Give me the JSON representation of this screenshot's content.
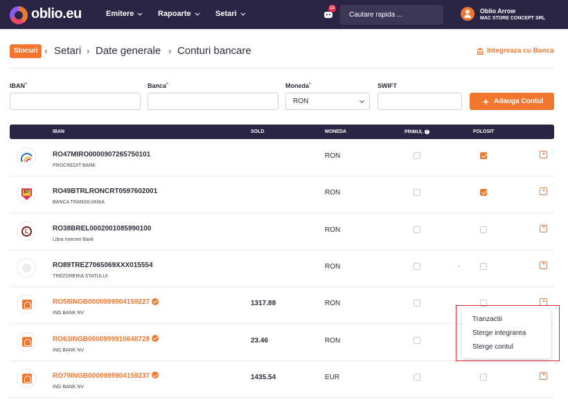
{
  "app": {
    "logo_text": "oblio.eu"
  },
  "nav": {
    "items": [
      "Emitere",
      "Rapoarte",
      "Setari"
    ],
    "notifications": "13",
    "search_placeholder": "Cautare rapida ..."
  },
  "user": {
    "name": "Oblio Arrow",
    "company": "MAC STORE CONCEPT SRL"
  },
  "breadcrumb": {
    "badge": "Stocuri",
    "sep": "›",
    "items": [
      "Setari",
      "Date generale",
      "Conturi bancare"
    ]
  },
  "integrate_label": "Integreaza cu Banca",
  "form": {
    "iban_label": "IBAN",
    "bank_label": "Banca",
    "currency_label": "Moneda",
    "swift_label": "SWIFT",
    "required": "*",
    "currency_value": "RON",
    "add_label": "Adauga Contul",
    "add_icon": "+"
  },
  "table": {
    "headers": {
      "iban": "IBAN",
      "sold": "SOLD",
      "moneda": "MONEDA",
      "primul": "PRIMUL",
      "folosit": "FOLOSIT"
    },
    "help_icon": "?",
    "rows": [
      {
        "iban": "RO47MIRO0000907265750101",
        "bank": "PROCREDIT BANK",
        "sold": "",
        "currency": "RON",
        "primul": false,
        "folosit": true,
        "logo": "procredit-logo-icon",
        "integrated": false,
        "dash": ""
      },
      {
        "iban": "RO49BTRLRONCRT0597602001",
        "bank": "BANCA TRANSILVANIA",
        "sold": "",
        "currency": "RON",
        "primul": false,
        "folosit": true,
        "logo": "bt-logo-icon",
        "integrated": false,
        "dash": ""
      },
      {
        "iban": "RO38BREL0002001085990100",
        "bank": "Libra Internet Bank",
        "sold": "",
        "currency": "RON",
        "primul": false,
        "folosit": false,
        "logo": "libra-logo-icon",
        "integrated": false,
        "dash": ""
      },
      {
        "iban": "RO89TREZ7065069XXX015554",
        "bank": "TREZORERIA STATULUI",
        "sold": "",
        "currency": "RON",
        "primul": false,
        "folosit": false,
        "logo": "trezorerie-logo-icon",
        "integrated": false,
        "dash": "-"
      },
      {
        "iban": "RO58INGB0000999904159227",
        "bank": "ING BANK NV",
        "sold": "1317.88",
        "currency": "RON",
        "primul": false,
        "folosit": false,
        "logo": "ing-logo-icon",
        "integrated": true,
        "dash": ""
      },
      {
        "iban": "RO63INGB0000999910648728",
        "bank": "ING BANK NV",
        "sold": "23.46",
        "currency": "RON",
        "primul": false,
        "folosit": false,
        "logo": "ing-logo-icon",
        "integrated": true,
        "dash": ""
      },
      {
        "iban": "RO79INGB0000999904159237",
        "bank": "ING BANK NV",
        "sold": "1435.54",
        "currency": "EUR",
        "primul": false,
        "folosit": false,
        "logo": "ing-logo-icon",
        "integrated": true,
        "dash": ""
      }
    ]
  },
  "context_menu": {
    "items": [
      "Tranzactii",
      "Sterge integrarea",
      "Sterge contul"
    ]
  },
  "colors": {
    "accent": "#f2772e",
    "nav_bg": "#2c2444",
    "highlight": "#d9282f"
  }
}
